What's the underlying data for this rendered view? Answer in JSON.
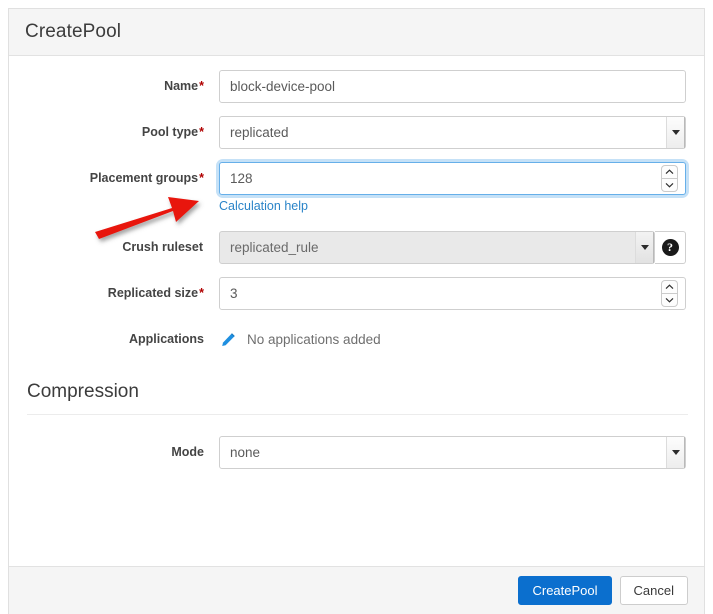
{
  "dialog": {
    "title": "CreatePool"
  },
  "form": {
    "name": {
      "label": "Name",
      "required_marker": "*",
      "value": "block-device-pool"
    },
    "pool_type": {
      "label": "Pool type",
      "required_marker": "*",
      "value": "replicated"
    },
    "placement_groups": {
      "label": "Placement groups",
      "required_marker": "*",
      "value": "128",
      "help_link": "Calculation help"
    },
    "crush_ruleset": {
      "label": "Crush ruleset",
      "required_marker": "",
      "value": "replicated_rule",
      "help_icon": "question-mark-icon"
    },
    "replicated_size": {
      "label": "Replicated size",
      "required_marker": "*",
      "value": "3"
    },
    "applications": {
      "label": "Applications",
      "edit_icon": "pencil-icon",
      "empty_text": "No applications added"
    }
  },
  "compression": {
    "section_title": "Compression",
    "mode": {
      "label": "Mode",
      "value": "none"
    }
  },
  "footer": {
    "submit_label": "CreatePool",
    "cancel_label": "Cancel"
  },
  "annotation": {
    "type": "red-arrow",
    "color": "#e8160c",
    "points_to": "placement-groups-input"
  },
  "colors": {
    "accent": "#0b6fce",
    "link": "#2a84c8",
    "required": "#b00000",
    "focus_ring": "#66afe9",
    "arrow": "#e8160c",
    "header_bg": "#f5f5f5"
  }
}
